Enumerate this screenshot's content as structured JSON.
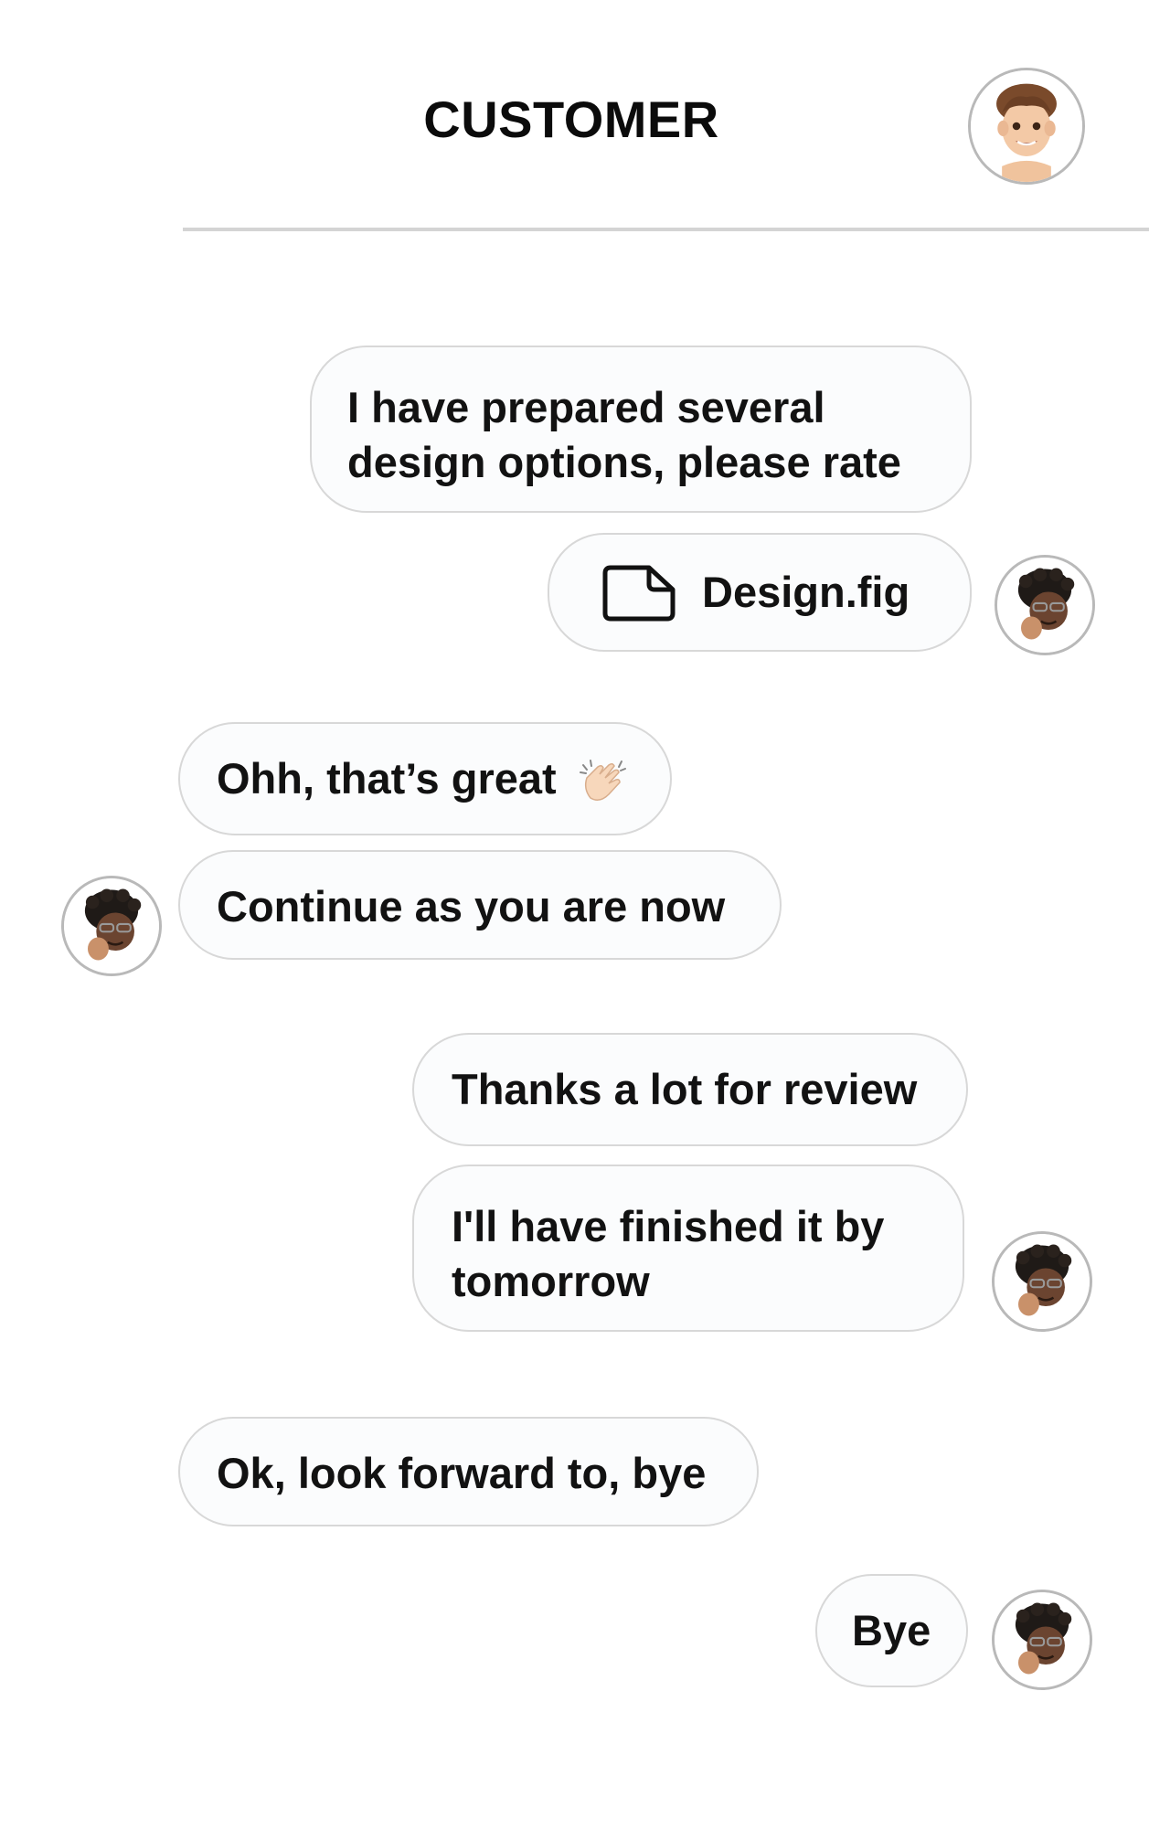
{
  "header": {
    "title": "CUSTOMER"
  },
  "messages": [
    {
      "side": "right",
      "line1": "I have prepared several",
      "line2": "design options, please rate"
    },
    {
      "side": "right",
      "type": "file",
      "icon": "file-icon",
      "filename": "Design.fig"
    },
    {
      "side": "left",
      "text": "Ohh, that’s great",
      "emoji": "clapping-hands-icon"
    },
    {
      "side": "left",
      "text": "Continue as you are now"
    },
    {
      "side": "right",
      "text": "Thanks a lot for review"
    },
    {
      "side": "right",
      "line1": "I'll have finished it by",
      "line2": "tomorrow"
    },
    {
      "side": "left",
      "text": "Ok, look forward to, bye"
    },
    {
      "side": "right",
      "text": "Bye"
    }
  ],
  "colors": {
    "bubble_bg": "#fbfcfd",
    "bubble_border": "#d8d8d8",
    "divider": "#d4d4d4",
    "text": "#121212"
  }
}
